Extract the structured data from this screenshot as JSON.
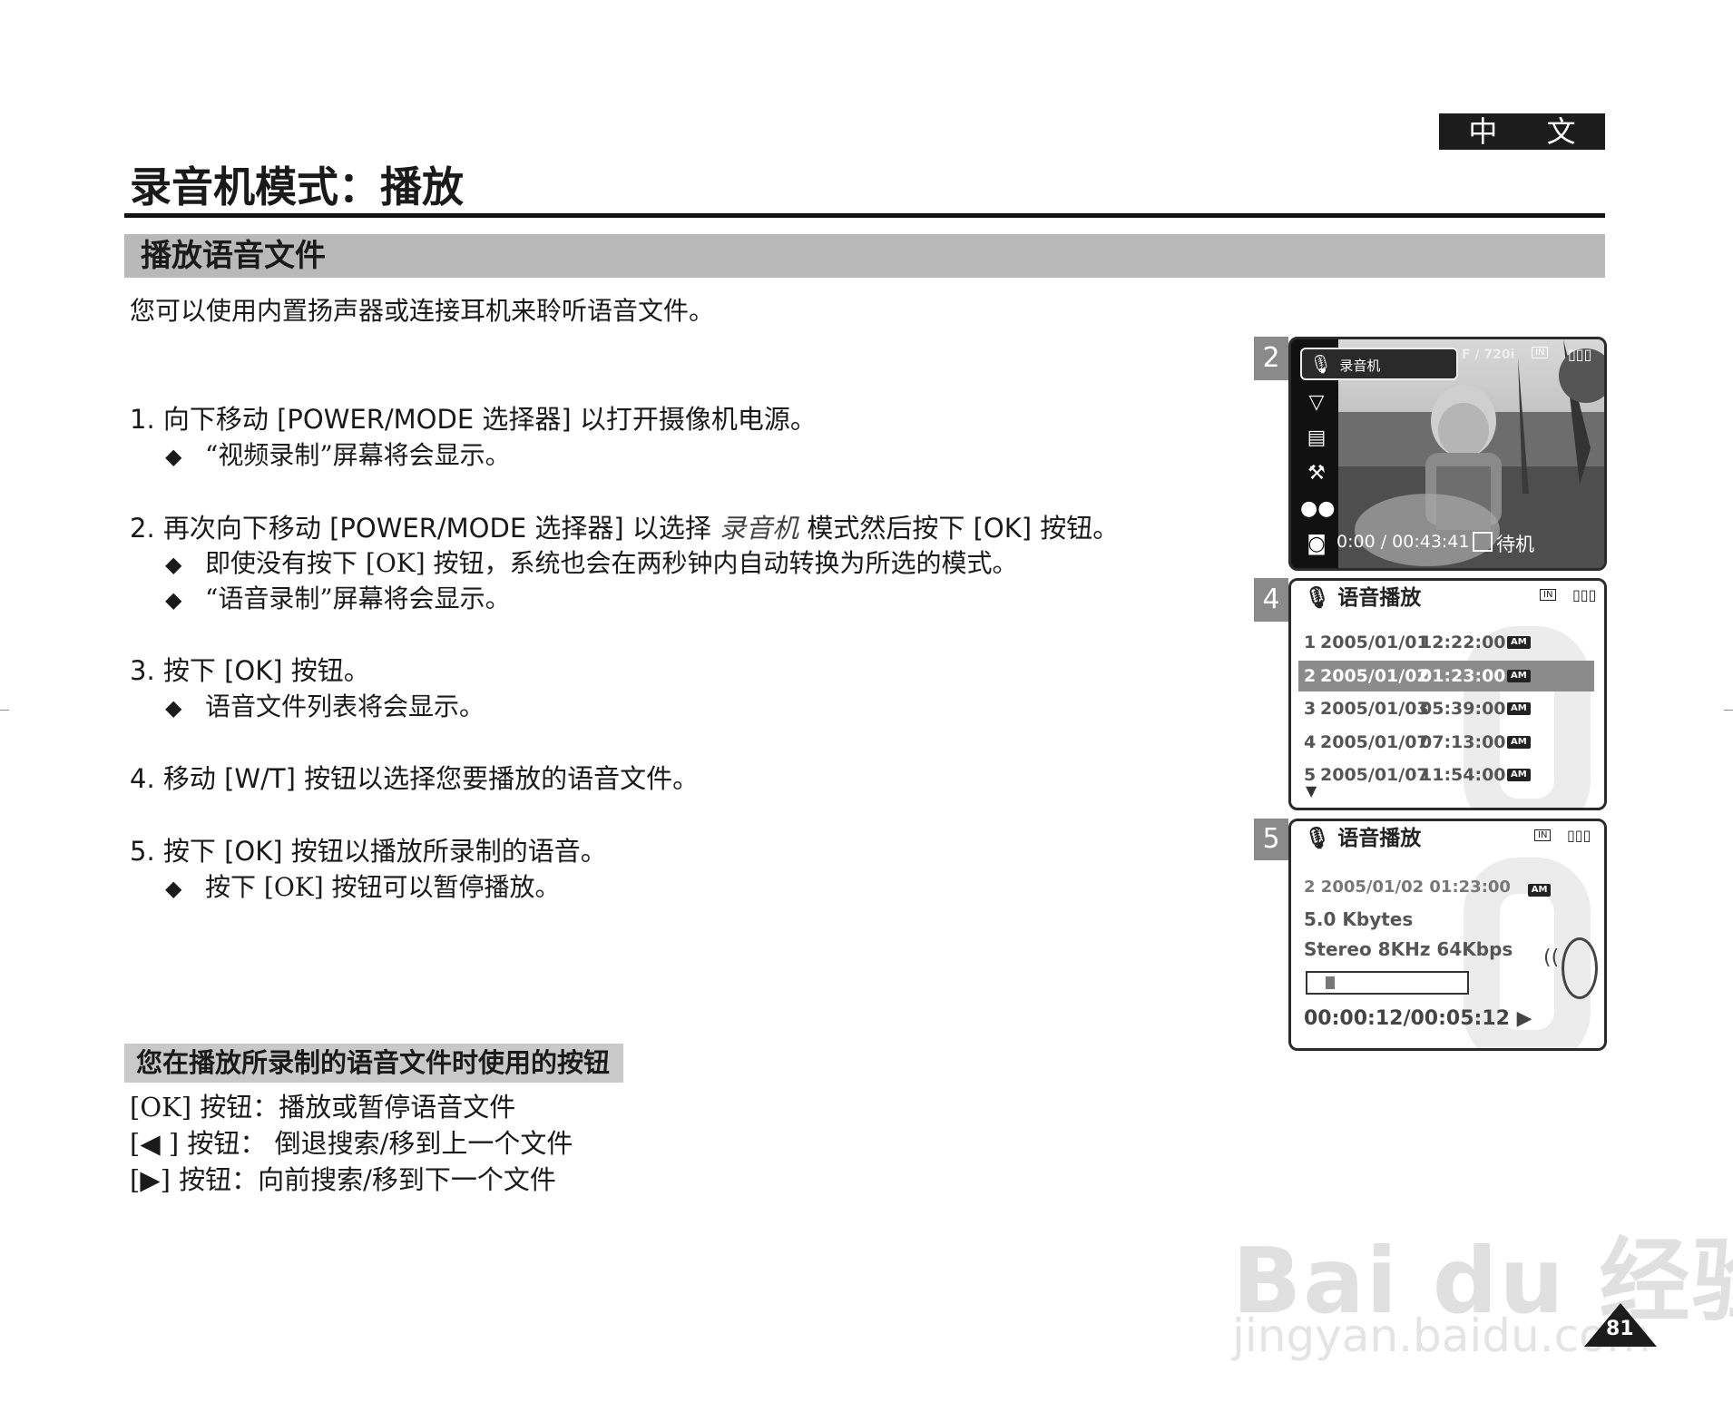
{
  "header": {
    "language_tab": "中 文",
    "page_title": "录音机模式：播放",
    "section_title": "播放语音文件"
  },
  "intro": "您可以使用内置扬声器或连接耳机来聆听语音文件。",
  "steps": [
    {
      "text": "1.  向下移动 [POWER/MODE 选择器] 以打开摄像机电源。",
      "bullets": [
        "“视频录制”屏幕将会显示。"
      ]
    },
    {
      "text_before": "2.  再次向下移动 [POWER/MODE 选择器] 以选择 ",
      "text_italic": "录音机",
      "text_after": " 模式然后按下 [OK] 按钮。",
      "bullets": [
        "即使没有按下 [OK] 按钮，系统也会在两秒钟内自动转换为所选的模式。",
        "“语音录制”屏幕将会显示。"
      ]
    },
    {
      "text": "3.  按下 [OK] 按钮。",
      "bullets": [
        "语音文件列表将会显示。"
      ]
    },
    {
      "text": "4.  移动 [W/T] 按钮以选择您要播放的语音文件。",
      "bullets": []
    },
    {
      "text": "5.  按下 [OK] 按钮以播放所录制的语音。",
      "bullets": [
        "按下 [OK] 按钮可以暂停播放。"
      ]
    }
  ],
  "buttons_section": {
    "title": "您在播放所录制的语音文件时使用的按钮",
    "lines": [
      "[OK] 按钮：播放或暂停语音文件",
      "[◀ ] 按钮： 倒退搜索/移到上一个文件",
      "[▶] 按钮：向前搜索/移到下一个文件"
    ]
  },
  "screen2": {
    "number": "2",
    "mode_label": "录音机",
    "quality": "F / 720i",
    "media": "IN",
    "timecode": "0:00 / 00:43:41",
    "status": "待机",
    "menu_icons": [
      "down-arrow-icon",
      "document-icon",
      "settings-icon",
      "video-camera-icon",
      "camera-icon",
      "music-note-icon"
    ]
  },
  "screen4": {
    "number": "4",
    "title": "语音播放",
    "media": "IN",
    "files": [
      {
        "index": "1",
        "date": "2005/01/01",
        "time": "12:22:00",
        "ampm": "AM",
        "selected": false
      },
      {
        "index": "2",
        "date": "2005/01/02",
        "time": "01:23:00",
        "ampm": "AM",
        "selected": true
      },
      {
        "index": "3",
        "date": "2005/01/03",
        "time": "05:39:00",
        "ampm": "AM",
        "selected": false
      },
      {
        "index": "4",
        "date": "2005/01/07",
        "time": "07:13:00",
        "ampm": "AM",
        "selected": false
      },
      {
        "index": "5",
        "date": "2005/01/07",
        "time": "11:54:00",
        "ampm": "AM",
        "selected": false
      }
    ]
  },
  "screen5": {
    "number": "5",
    "title": "语音播放",
    "media": "IN",
    "file_line": "2  2005/01/02 01:23:00",
    "ampm": "AM",
    "size": "5.0 Kbytes",
    "format": "Stereo  8KHz  64Kbps",
    "progress": 0.04,
    "time": "00:00:12/00:05:12 ▶"
  },
  "watermark": {
    "brand": "Bai du 经验",
    "url": "jingyan.baidu.com"
  },
  "page_number": "81"
}
